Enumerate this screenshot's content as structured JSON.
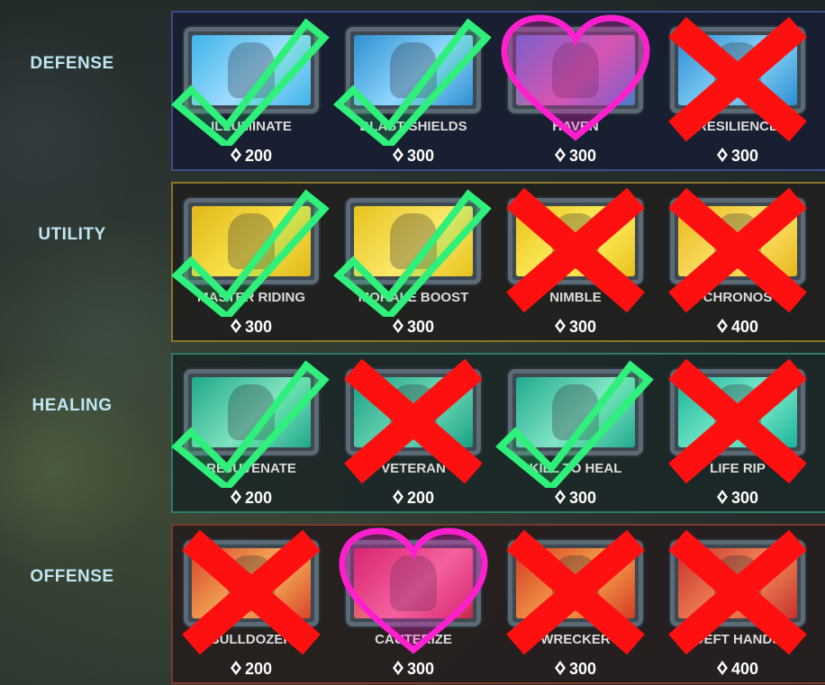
{
  "rows": [
    {
      "label": "DEFENSE",
      "cards": [
        {
          "name": "ILLUMINATE",
          "cost": "200",
          "mark": "check",
          "art": [
            "#3fb4e8",
            "#9fdcff"
          ]
        },
        {
          "name": "BLAST SHIELDS",
          "cost": "300",
          "mark": "check",
          "art": [
            "#2f8fd0",
            "#8fd6ff"
          ]
        },
        {
          "name": "HAVEN",
          "cost": "300",
          "mark": "heart",
          "art": [
            "#4a78c8",
            "#c86aa6"
          ]
        },
        {
          "name": "RESILIENCE",
          "cost": "300",
          "mark": "x",
          "art": [
            "#2a8ed4",
            "#8ad2f6"
          ]
        }
      ]
    },
    {
      "label": "UTILITY",
      "cards": [
        {
          "name": "MASTER RIDING",
          "cost": "300",
          "mark": "check",
          "art": [
            "#e0b81a",
            "#f8e24a"
          ]
        },
        {
          "name": "MORALE BOOST",
          "cost": "300",
          "mark": "check",
          "art": [
            "#e6c21c",
            "#fbe86a"
          ]
        },
        {
          "name": "NIMBLE",
          "cost": "300",
          "mark": "x",
          "art": [
            "#e8c01a",
            "#fff060"
          ]
        },
        {
          "name": "CHRONOS",
          "cost": "400",
          "mark": "x",
          "art": [
            "#e8b61c",
            "#fde46a"
          ]
        }
      ]
    },
    {
      "label": "HEALING",
      "cards": [
        {
          "name": "REJUVENATE",
          "cost": "200",
          "mark": "check",
          "art": [
            "#1ea98a",
            "#7fe2c0"
          ]
        },
        {
          "name": "VETERAN",
          "cost": "200",
          "mark": "x",
          "art": [
            "#18a084",
            "#6fd9b6"
          ]
        },
        {
          "name": "KILL TO HEAL",
          "cost": "300",
          "mark": "check",
          "art": [
            "#20aa8e",
            "#82e4c6"
          ]
        },
        {
          "name": "LIFE RIP",
          "cost": "300",
          "mark": "x",
          "art": [
            "#1ab39a",
            "#7deccc"
          ]
        }
      ]
    },
    {
      "label": "OFFENSE",
      "cards": [
        {
          "name": "BULLDOZER",
          "cost": "200",
          "mark": "x",
          "art": [
            "#d8452a",
            "#f6b25a"
          ]
        },
        {
          "name": "CAUTERIZE",
          "cost": "300",
          "mark": "heart",
          "art": [
            "#c8284a",
            "#f07a8a"
          ]
        },
        {
          "name": "WRECKER",
          "cost": "300",
          "mark": "x",
          "art": [
            "#d63a24",
            "#f4a24a"
          ]
        },
        {
          "name": "DEFT HANDS",
          "cost": "400",
          "mark": "x",
          "art": [
            "#c8302a",
            "#f08a5a"
          ]
        }
      ]
    }
  ],
  "marks": {
    "check_color": "#2ef07a",
    "x_color": "#ff1010",
    "heart_color": "#ff1fcf"
  }
}
